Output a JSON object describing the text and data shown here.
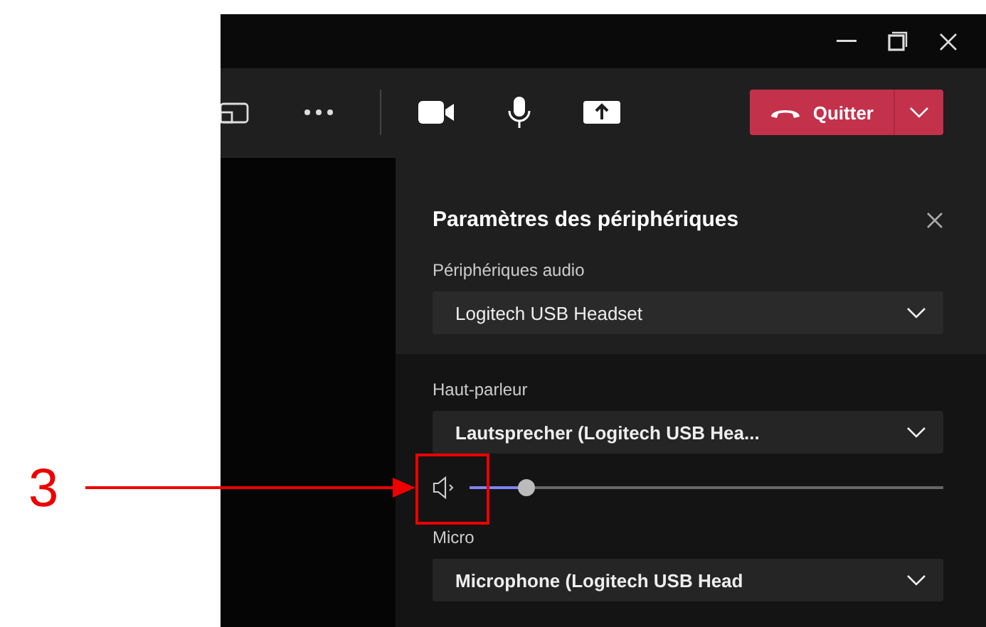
{
  "toolbar": {
    "leave_button": {
      "label": "Quitter"
    }
  },
  "device_panel": {
    "title": "Paramètres des périphériques",
    "audio_devices": {
      "label": "Périphériques audio",
      "value": "Logitech USB Headset"
    },
    "speaker": {
      "label": "Haut-parleur",
      "value": "Lautsprecher (Logitech USB Hea...",
      "volume": {
        "level": 0.12
      }
    },
    "microphone": {
      "label": "Micro",
      "value": "Microphone (Logitech USB Head"
    }
  },
  "annotation": {
    "number": "3"
  }
}
